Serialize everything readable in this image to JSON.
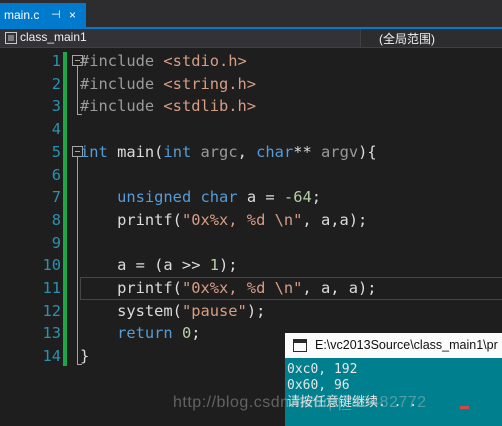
{
  "tab": {
    "label": "main.c",
    "pin": "⊣",
    "close": "×"
  },
  "navbar": {
    "scope": "class_main1",
    "member": "(全局范围)"
  },
  "editor": {
    "lines": [
      {
        "num": "1",
        "tokens": [
          {
            "t": "#include ",
            "c": "pp"
          },
          {
            "t": "<stdio.h>",
            "c": "str"
          }
        ]
      },
      {
        "num": "2",
        "tokens": [
          {
            "t": "#include ",
            "c": "pp"
          },
          {
            "t": "<string.h>",
            "c": "str"
          }
        ]
      },
      {
        "num": "3",
        "tokens": [
          {
            "t": "#include ",
            "c": "pp"
          },
          {
            "t": "<stdlib.h>",
            "c": "str"
          }
        ]
      },
      {
        "num": "4",
        "tokens": []
      },
      {
        "num": "5",
        "tokens": [
          {
            "t": "int",
            "c": "kw"
          },
          {
            "t": " main(",
            "c": ""
          },
          {
            "t": "int",
            "c": "kw"
          },
          {
            "t": " ",
            "c": ""
          },
          {
            "t": "argc",
            "c": "prm"
          },
          {
            "t": ", ",
            "c": ""
          },
          {
            "t": "char",
            "c": "kw"
          },
          {
            "t": "** ",
            "c": ""
          },
          {
            "t": "argv",
            "c": "prm"
          },
          {
            "t": "){",
            "c": ""
          }
        ]
      },
      {
        "num": "6",
        "tokens": []
      },
      {
        "num": "7",
        "tokens": [
          {
            "t": "    ",
            "c": ""
          },
          {
            "t": "unsigned",
            "c": "kw"
          },
          {
            "t": " ",
            "c": ""
          },
          {
            "t": "char",
            "c": "kw"
          },
          {
            "t": " a = ",
            "c": ""
          },
          {
            "t": "-64",
            "c": "num"
          },
          {
            "t": ";",
            "c": ""
          }
        ]
      },
      {
        "num": "8",
        "tokens": [
          {
            "t": "    printf(",
            "c": ""
          },
          {
            "t": "\"0x%x, %d \\n\"",
            "c": "str"
          },
          {
            "t": ", a,a);",
            "c": ""
          }
        ]
      },
      {
        "num": "9",
        "tokens": []
      },
      {
        "num": "10",
        "tokens": [
          {
            "t": "    a = (a >> ",
            "c": ""
          },
          {
            "t": "1",
            "c": "num"
          },
          {
            "t": ");",
            "c": ""
          }
        ]
      },
      {
        "num": "11",
        "tokens": [
          {
            "t": "    printf(",
            "c": ""
          },
          {
            "t": "\"0x%x, %d \\n\"",
            "c": "str"
          },
          {
            "t": ", a, a);",
            "c": ""
          }
        ]
      },
      {
        "num": "12",
        "tokens": [
          {
            "t": "    system(",
            "c": ""
          },
          {
            "t": "\"pause\"",
            "c": "str"
          },
          {
            "t": ");",
            "c": ""
          }
        ]
      },
      {
        "num": "13",
        "tokens": [
          {
            "t": "    ",
            "c": ""
          },
          {
            "t": "return",
            "c": "kw"
          },
          {
            "t": " ",
            "c": ""
          },
          {
            "t": "0",
            "c": "num"
          },
          {
            "t": ";",
            "c": ""
          }
        ]
      },
      {
        "num": "14",
        "tokens": [
          {
            "t": "}",
            "c": ""
          }
        ]
      }
    ]
  },
  "console": {
    "title": "E:\\vc2013Source\\class_main1\\pr",
    "lines": [
      "0xc0, 192",
      "0x60, 96",
      "请按任意键继续. . ."
    ]
  },
  "watermark": "http://blog.csdn.net/qq_36482772",
  "colors": {
    "accent": "#007acc",
    "change_bar": "#1ea64b",
    "console_bg": "#00808e"
  }
}
